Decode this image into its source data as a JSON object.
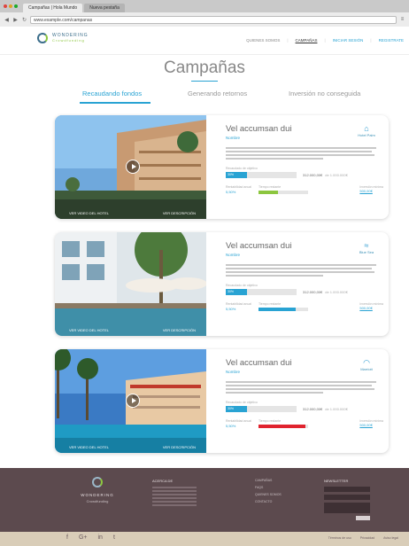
{
  "browser": {
    "tabs": [
      "Campañas | Hola Mundo",
      "Nueva pestaña"
    ],
    "url": "www.example.com/campanas"
  },
  "header": {
    "logo_line1": "WONDERING",
    "logo_line2": "Crowdfunding",
    "nav": [
      {
        "label": "QUIENES SOMOS"
      },
      {
        "label": "CAMPAÑAS"
      },
      {
        "label": "INICIAR SESIÓN"
      },
      {
        "label": "REGISTRATE"
      }
    ]
  },
  "page_title": "Campañas",
  "tabs": [
    "Recaudando fondos",
    "Generando retornos",
    "Inversión no conseguida"
  ],
  "cards": [
    {
      "title": "Vel accumsan dui",
      "subtitle": "Nombre",
      "brand": "Hotel Palm",
      "progress_label": "Recaudado de objetivo",
      "progress_pct": 0.3,
      "progress_text": "30%",
      "amount": "312.000,00€",
      "amount_goal": "de 1.000.000€",
      "stat1_label": "Rentabilidad anual",
      "stat1_value": "5,50%",
      "stat2_label": "Tiempo restante",
      "stat2_pct": 0.4,
      "stat2_color": "#8cc63f",
      "link_label": "Inversión mínima",
      "link": "500,00€",
      "caption_left": "VER VIDEO DEL HOTEL",
      "caption_right": "VER DESCRIPCIÓN"
    },
    {
      "title": "Vel accumsan dui",
      "subtitle": "Nombre",
      "brand": "Blue Sea",
      "progress_label": "Recaudado de objetivo",
      "progress_pct": 0.3,
      "progress_text": "30%",
      "amount": "312.000,00€",
      "amount_goal": "de 1.000.000€",
      "stat1_label": "Rentabilidad anual",
      "stat1_value": "5,50%",
      "stat2_label": "Tiempo restante",
      "stat2_pct": 0.75,
      "stat2_color": "#29a3d3",
      "link_label": "Inversión mínima",
      "link": "500,00€",
      "caption_left": "VER VIDEO DEL HOTEL",
      "caption_right": "VER DESCRIPCIÓN"
    },
    {
      "title": "Vel accumsan dui",
      "subtitle": "Nombre",
      "brand": "Marriott",
      "progress_label": "Recaudado de objetivo",
      "progress_pct": 0.3,
      "progress_text": "30%",
      "amount": "312.000,00€",
      "amount_goal": "de 1.000.000€",
      "stat1_label": "Rentabilidad anual",
      "stat1_value": "5,50%",
      "stat2_label": "Tiempo restante",
      "stat2_pct": 0.95,
      "stat2_color": "#e0232e",
      "link_label": "Inversión mínima",
      "link": "500,00€",
      "caption_left": "VER VIDEO DEL HOTEL",
      "caption_right": "VER DESCRIPCIÓN"
    }
  ],
  "footer": {
    "logo_line1": "WONDERING",
    "logo_line2": "Crowdfunding",
    "col2_head": "ACERCA DE",
    "col3_items": [
      "CAMPAÑAS",
      "FAQS",
      "QUIENES SOMOS",
      "CONTACTO"
    ],
    "col4_head": "NEWSLETTER",
    "social": [
      "f",
      "G+",
      "in",
      "t"
    ],
    "legal": [
      "Términos de uso",
      "Privacidad",
      "Aviso legal"
    ]
  },
  "colors": {
    "accent": "#29a3d3",
    "footer": "#5c4a4e",
    "footer_bottom": "#d9cdb8"
  }
}
